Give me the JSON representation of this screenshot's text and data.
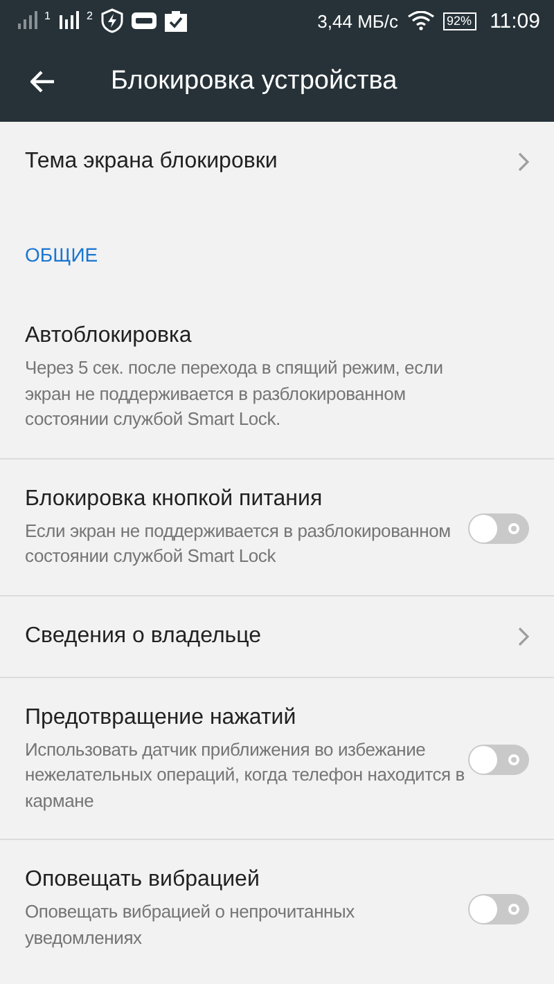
{
  "status_bar": {
    "sim_labels": [
      "1",
      "2"
    ],
    "speed": "3,44 МБ/с",
    "battery": "92%",
    "time": "11:09"
  },
  "app_bar": {
    "title": "Блокировка устройства"
  },
  "sections": [
    {
      "items": [
        {
          "kind": "nav",
          "title": "Тема экрана блокировки"
        }
      ]
    },
    {
      "header": "ОБЩИЕ",
      "items": [
        {
          "kind": "plain",
          "title": "Автоблокировка",
          "summary": "Через 5 сек. после перехода в спящий режим, если экран не поддерживается в разблокированном состоянии службой Smart Lock."
        },
        {
          "kind": "toggle",
          "title": "Блокировка кнопкой питания",
          "summary": "Если экран не поддерживается в разблокированном состоянии службой Smart Lock",
          "on": false
        },
        {
          "kind": "nav",
          "title": "Сведения о владельце"
        },
        {
          "kind": "toggle",
          "title": "Предотвращение нажатий",
          "summary": "Использовать датчик приближения во избежание нежелательных операций, когда телефон находится в кармане",
          "on": false
        },
        {
          "kind": "toggle",
          "title": "Оповещать вибрацией",
          "summary": "Оповещать вибрацией о непрочитанных уведомлениях",
          "on": false
        }
      ]
    }
  ]
}
